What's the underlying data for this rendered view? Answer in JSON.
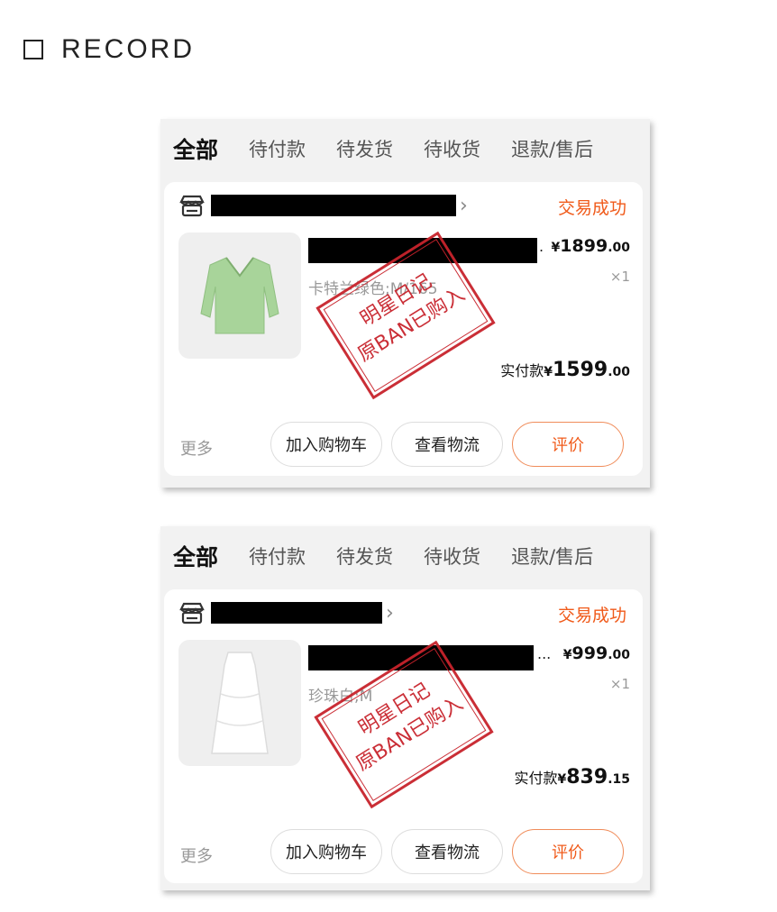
{
  "header": {
    "title": "RECORD"
  },
  "tabs": [
    "全部",
    "待付款",
    "待发货",
    "待收货",
    "退款/售后"
  ],
  "orders": [
    {
      "status": "交易成功",
      "variant": "卡特兰绿色;M/165",
      "price_yen": "¥",
      "price_int": "1899",
      "price_dec": ".00",
      "qty": "×1",
      "paid_label": "实付款",
      "paid_yen": "¥",
      "paid_int": "1599",
      "paid_dec": ".00",
      "more": "更多",
      "btn_cart": "加入购物车",
      "btn_logistics": "查看物流",
      "btn_rate": "评价",
      "trailing": ".",
      "thumb_color": "#a8d49a"
    },
    {
      "status": "交易成功",
      "variant": "珍珠白;M",
      "price_yen": "¥",
      "price_int": "999",
      "price_dec": ".00",
      "qty": "×1",
      "paid_label": "实付款",
      "paid_yen": "¥",
      "paid_int": "839",
      "paid_dec": ".15",
      "more": "更多",
      "btn_cart": "加入购物车",
      "btn_logistics": "查看物流",
      "btn_rate": "评价",
      "trailing": "...",
      "thumb_color": "#ffffff"
    }
  ],
  "stamp": {
    "line1": "明星日记",
    "line2": "原BAN已购入",
    "color": "#c8232c"
  },
  "colors": {
    "accent": "#f05a1a",
    "redaction": "#000000"
  }
}
